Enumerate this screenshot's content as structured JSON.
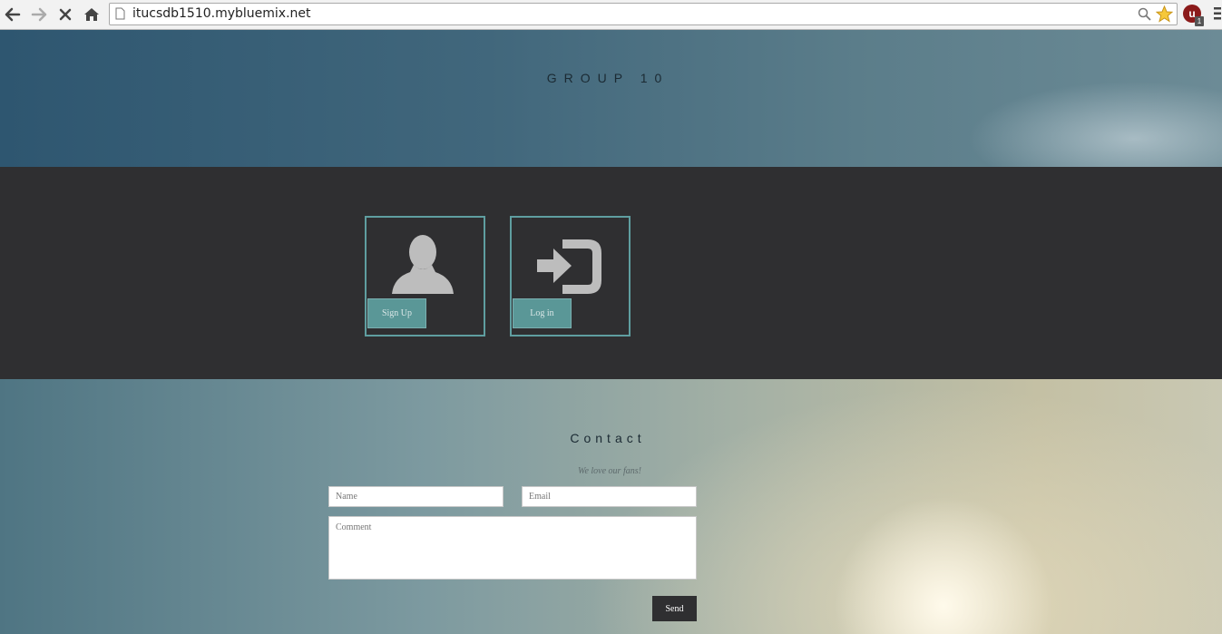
{
  "browser": {
    "url": "itucsdb1510.mybluemix.net",
    "extension_badge": "u",
    "extension_count": "1"
  },
  "hero": {
    "title": "GROUP 10"
  },
  "actions": {
    "signup_label": "Sign Up",
    "login_label": "Log in",
    "accent_color": "#5f9ea0"
  },
  "contact": {
    "title": "Contact",
    "subtitle": "We love our fans!",
    "name_placeholder": "Name",
    "email_placeholder": "Email",
    "comment_placeholder": "Comment",
    "send_label": "Send"
  }
}
